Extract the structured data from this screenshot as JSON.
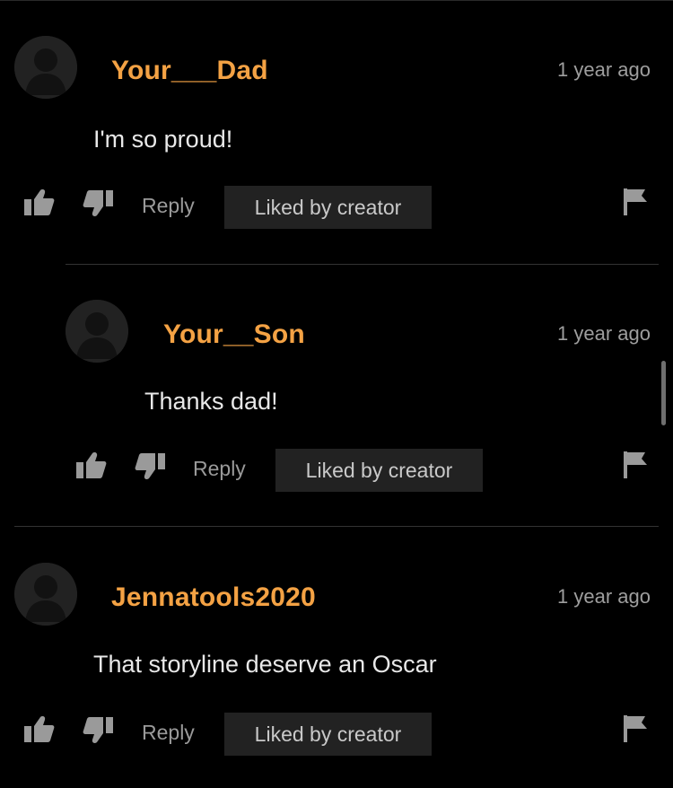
{
  "comments": [
    {
      "username": "Your___Dad",
      "timestamp": "1 year ago",
      "text": "I'm so proud!",
      "reply_label": "Reply",
      "badge": "Liked by creator"
    },
    {
      "username": "Your__Son",
      "timestamp": "1 year ago",
      "text": "Thanks dad!",
      "reply_label": "Reply",
      "badge": "Liked by creator"
    },
    {
      "username": "Jennatools2020",
      "timestamp": "1 year ago",
      "text": "That storyline deserve an Oscar",
      "reply_label": "Reply",
      "badge": "Liked by creator"
    }
  ],
  "icons": {
    "avatar": "avatar-placeholder-icon",
    "like": "thumbs-up-icon",
    "dislike": "thumbs-down-icon",
    "report": "flag-icon"
  },
  "colors": {
    "background": "#000000",
    "username": "#f4a244",
    "badge_bg": "#222222",
    "muted": "#9e9e9e"
  }
}
